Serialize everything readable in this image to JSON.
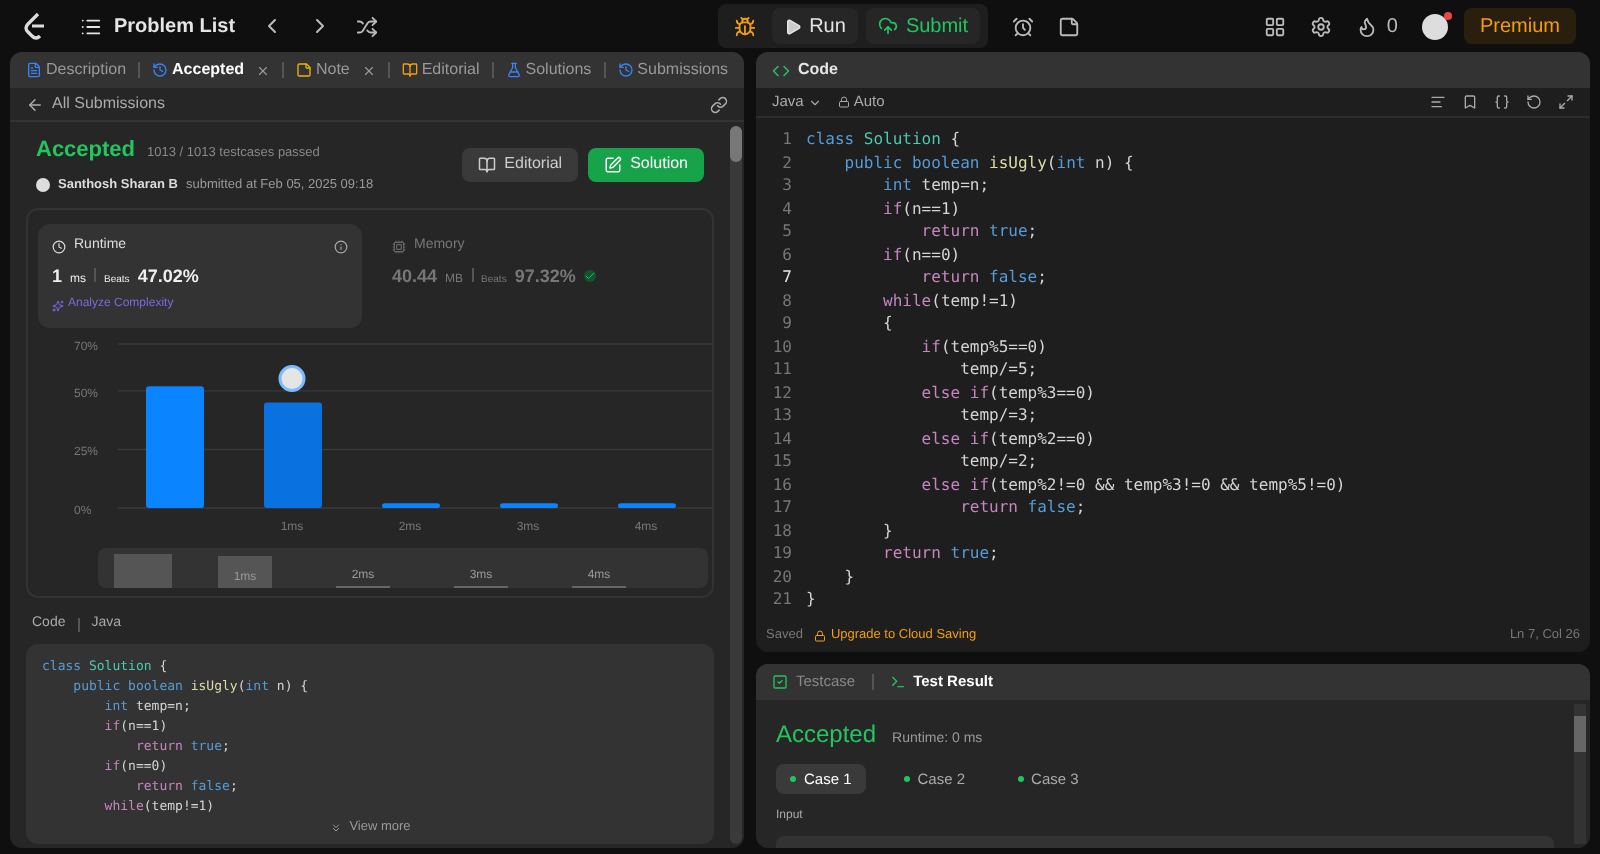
{
  "topbar": {
    "title": "Problem List",
    "run": "Run",
    "submit": "Submit",
    "streak": "0",
    "premium": "Premium"
  },
  "left_tabs": [
    {
      "label": "Description",
      "kind": "description",
      "selected": false,
      "closable": false
    },
    {
      "label": "Accepted",
      "kind": "accepted",
      "selected": true,
      "closable": true
    },
    {
      "label": "Note",
      "kind": "note",
      "selected": false,
      "closable": true
    },
    {
      "label": "Editorial",
      "kind": "editorial",
      "selected": false,
      "closable": false
    },
    {
      "label": "Solutions",
      "kind": "solutions",
      "selected": false,
      "closable": false
    },
    {
      "label": "Submissions",
      "kind": "submissions",
      "selected": false,
      "closable": false
    }
  ],
  "back_link": "All Submissions",
  "submission": {
    "status": "Accepted",
    "passed": "1013 / 1013 testcases passed",
    "author": "Santhosh Sharan B",
    "submitted": "submitted at Feb 05, 2025 09:18",
    "editorial_button": "Editorial",
    "solution_button": "Solution"
  },
  "stats": [
    {
      "kind": "runtime",
      "title": "Runtime",
      "value": "1",
      "unit": "ms",
      "beats_label": "Beats",
      "beats": "47.02%",
      "extra": "Analyze Complexity",
      "selected": true
    },
    {
      "kind": "memory",
      "title": "Memory",
      "value": "40.44",
      "unit": "MB",
      "beats_label": "Beats",
      "beats": "97.32%",
      "selected": false
    }
  ],
  "chart": {
    "chart_data": {
      "type": "bar",
      "categories": [
        null,
        "1ms",
        "2ms",
        "3ms",
        "4ms"
      ],
      "values": [
        52,
        45,
        2,
        2,
        2
      ],
      "ylim": [
        0,
        70
      ],
      "yticks": [
        {
          "value": 0,
          "label": "0%"
        },
        {
          "value": 25,
          "label": "25%"
        },
        {
          "value": 50,
          "label": "50%"
        },
        {
          "value": 70,
          "label": "70%"
        }
      ]
    },
    "overview_labels": [
      "1ms",
      "2ms",
      "3ms",
      "4ms"
    ]
  },
  "code_preview": {
    "label": "Code",
    "language": "Java",
    "view_more": "View more",
    "lines": [
      [
        {
          "text": "class ",
          "kind": "k"
        },
        {
          "text": "Solution",
          "kind": "t"
        },
        {
          "text": " {",
          "kind": "p"
        }
      ],
      [
        {
          "text": "    public boolean ",
          "kind": "k"
        },
        {
          "text": "isUgly",
          "kind": "f"
        },
        {
          "text": "(",
          "kind": "p"
        },
        {
          "text": "int",
          "kind": "k"
        },
        {
          "text": " n) {",
          "kind": "p"
        }
      ],
      [
        {
          "text": "        int ",
          "kind": "k"
        },
        {
          "text": "temp=n;",
          "kind": "p"
        }
      ],
      [
        {
          "text": "        if",
          "kind": "c"
        },
        {
          "text": "(n==1)",
          "kind": "p"
        }
      ],
      [
        {
          "text": "            return ",
          "kind": "c"
        },
        {
          "text": "true",
          "kind": "k"
        },
        {
          "text": ";",
          "kind": "p"
        }
      ],
      [
        {
          "text": "        if",
          "kind": "c"
        },
        {
          "text": "(n==0)",
          "kind": "p"
        }
      ],
      [
        {
          "text": "            return ",
          "kind": "c"
        },
        {
          "text": "false",
          "kind": "k"
        },
        {
          "text": ";",
          "kind": "p"
        }
      ],
      [
        {
          "text": "        while",
          "kind": "c"
        },
        {
          "text": "(temp!=1)",
          "kind": "p"
        }
      ]
    ]
  },
  "editor": {
    "title": "Code",
    "language": "Java",
    "mode": "Auto",
    "lines": [
      {
        "no": "1",
        "current": false,
        "tokens": [
          {
            "text": "class ",
            "kind": "k"
          },
          {
            "text": "Solution",
            "kind": "t"
          },
          {
            "text": " {",
            "kind": "p"
          }
        ]
      },
      {
        "no": "2",
        "current": false,
        "tokens": [
          {
            "text": "    public boolean ",
            "kind": "k"
          },
          {
            "text": "isUgly",
            "kind": "f"
          },
          {
            "text": "(",
            "kind": "p"
          },
          {
            "text": "int",
            "kind": "k"
          },
          {
            "text": " n) {",
            "kind": "p"
          }
        ]
      },
      {
        "no": "3",
        "current": false,
        "tokens": [
          {
            "text": "        int ",
            "kind": "k"
          },
          {
            "text": "temp=n;",
            "kind": "p"
          }
        ]
      },
      {
        "no": "4",
        "current": false,
        "tokens": [
          {
            "text": "        if",
            "kind": "c"
          },
          {
            "text": "(n==1)",
            "kind": "p"
          }
        ]
      },
      {
        "no": "5",
        "current": false,
        "tokens": [
          {
            "text": "            return ",
            "kind": "c"
          },
          {
            "text": "true",
            "kind": "k"
          },
          {
            "text": ";",
            "kind": "p"
          }
        ]
      },
      {
        "no": "6",
        "current": false,
        "tokens": [
          {
            "text": "        if",
            "kind": "c"
          },
          {
            "text": "(n==0)",
            "kind": "p"
          }
        ]
      },
      {
        "no": "7",
        "current": true,
        "tokens": [
          {
            "text": "            return ",
            "kind": "c"
          },
          {
            "text": "false",
            "kind": "k"
          },
          {
            "text": ";",
            "kind": "p"
          }
        ]
      },
      {
        "no": "8",
        "current": false,
        "tokens": [
          {
            "text": "        while",
            "kind": "c"
          },
          {
            "text": "(temp!=1)",
            "kind": "p"
          }
        ]
      },
      {
        "no": "9",
        "current": false,
        "tokens": [
          {
            "text": "        {",
            "kind": "p"
          }
        ]
      },
      {
        "no": "10",
        "current": false,
        "tokens": [
          {
            "text": "            if",
            "kind": "c"
          },
          {
            "text": "(temp%5==0)",
            "kind": "p"
          }
        ]
      },
      {
        "no": "11",
        "current": false,
        "tokens": [
          {
            "text": "                temp/=5;",
            "kind": "p"
          }
        ]
      },
      {
        "no": "12",
        "current": false,
        "tokens": [
          {
            "text": "            else if",
            "kind": "c"
          },
          {
            "text": "(temp%3==0)",
            "kind": "p"
          }
        ]
      },
      {
        "no": "13",
        "current": false,
        "tokens": [
          {
            "text": "                temp/=3;",
            "kind": "p"
          }
        ]
      },
      {
        "no": "14",
        "current": false,
        "tokens": [
          {
            "text": "            else if",
            "kind": "c"
          },
          {
            "text": "(temp%2==0)",
            "kind": "p"
          }
        ]
      },
      {
        "no": "15",
        "current": false,
        "tokens": [
          {
            "text": "                temp/=2;",
            "kind": "p"
          }
        ]
      },
      {
        "no": "16",
        "current": false,
        "tokens": [
          {
            "text": "            else if",
            "kind": "c"
          },
          {
            "text": "(temp%2!=0 && temp%3!=0 && temp%5!=0)",
            "kind": "p"
          }
        ]
      },
      {
        "no": "17",
        "current": false,
        "tokens": [
          {
            "text": "                return ",
            "kind": "c"
          },
          {
            "text": "false",
            "kind": "k"
          },
          {
            "text": ";",
            "kind": "p"
          }
        ]
      },
      {
        "no": "18",
        "current": false,
        "tokens": [
          {
            "text": "        }",
            "kind": "p"
          }
        ]
      },
      {
        "no": "19",
        "current": false,
        "tokens": [
          {
            "text": "        return ",
            "kind": "c"
          },
          {
            "text": "true",
            "kind": "k"
          },
          {
            "text": ";",
            "kind": "p"
          }
        ]
      },
      {
        "no": "20",
        "current": false,
        "tokens": [
          {
            "text": "    }",
            "kind": "p"
          }
        ]
      },
      {
        "no": "21",
        "current": false,
        "tokens": [
          {
            "text": "}",
            "kind": "p"
          }
        ]
      }
    ],
    "saved": "Saved",
    "upgrade": "Upgrade to Cloud Saving",
    "cursor": "Ln 7, Col 26"
  },
  "test_panel": {
    "tabs": [
      {
        "label": "Testcase",
        "kind": "testcase",
        "selected": false
      },
      {
        "label": "Test Result",
        "kind": "result",
        "selected": true
      }
    ],
    "status": "Accepted",
    "runtime": "Runtime: 0 ms",
    "cases": [
      {
        "label": "Case 1",
        "selected": true
      },
      {
        "label": "Case 2",
        "selected": false
      },
      {
        "label": "Case 3",
        "selected": false
      }
    ],
    "input_label": "Input"
  }
}
